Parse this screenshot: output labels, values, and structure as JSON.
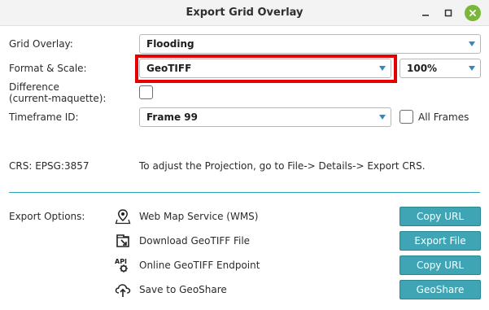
{
  "window": {
    "title": "Export Grid Overlay",
    "close_color": "#79b63a"
  },
  "form": {
    "grid_overlay_label": "Grid Overlay:",
    "grid_overlay_value": "Flooding",
    "format_label": "Format & Scale:",
    "format_value": "GeoTIFF",
    "scale_value": "100%",
    "difference_label_line1": "Difference",
    "difference_label_line2": "(current-maquette):",
    "difference_checked": false,
    "timeframe_label": "Timeframe ID:",
    "timeframe_value": "Frame 99",
    "all_frames_label": "All Frames",
    "all_frames_checked": false,
    "crs_label": "CRS: EPSG:3857",
    "crs_hint": "To adjust the Projection, go to File-> Details-> Export CRS."
  },
  "export": {
    "label": "Export Options:",
    "options": [
      {
        "icon": "map-pin-icon",
        "text": "Web Map Service (WMS)",
        "button": "Copy URL"
      },
      {
        "icon": "download-file-icon",
        "text": "Download GeoTIFF File",
        "button": "Export File"
      },
      {
        "icon": "api-icon",
        "text": "Online GeoTIFF Endpoint",
        "button": "Copy URL"
      },
      {
        "icon": "cloud-upload-icon",
        "text": "Save to GeoShare",
        "button": "GeoShare"
      }
    ]
  },
  "colors": {
    "accent": "#2f8ac4",
    "button": "#3fa5b4",
    "highlight": "#e40000",
    "divider": "#2fa7b8"
  }
}
